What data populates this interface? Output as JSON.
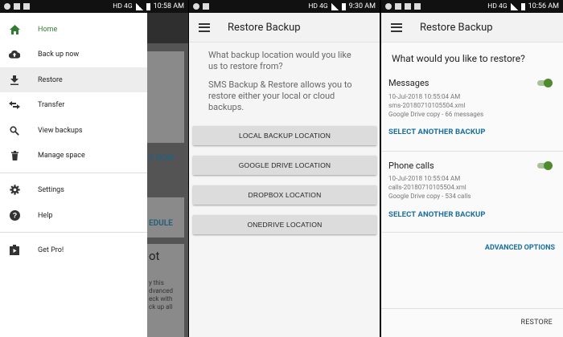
{
  "panel1": {
    "status": {
      "time": "10:58 AM",
      "network": "HD 4G"
    },
    "background": {
      "backup_now_fragment": "P NOW",
      "schedule_fragment": "EDULE",
      "got_fragment": "ot",
      "desc_fragment": [
        "y this",
        "dvanced",
        "eck with",
        "ck up all"
      ]
    },
    "drawer_items": [
      {
        "label": "Home",
        "icon": "home-icon"
      },
      {
        "label": "Back up now",
        "icon": "cloud-upload-icon"
      },
      {
        "label": "Restore",
        "icon": "download-icon"
      },
      {
        "label": "Transfer",
        "icon": "transfer-icon"
      },
      {
        "label": "View backups",
        "icon": "search-icon"
      },
      {
        "label": "Manage space",
        "icon": "trash-icon"
      },
      {
        "label": "Settings",
        "icon": "gear-icon"
      },
      {
        "label": "Help",
        "icon": "help-icon"
      },
      {
        "label": "Get Pro!",
        "icon": "play-store-icon"
      }
    ]
  },
  "panel2": {
    "status": {
      "time": "9:30 AM",
      "network": "HD 4G"
    },
    "title": "Restore Backup",
    "question": "What backup location would you like us to restore from?",
    "description": "SMS Backup & Restore allows you to restore either your local or cloud backups.",
    "buttons": [
      "LOCAL BACKUP LOCATION",
      "GOOGLE DRIVE LOCATION",
      "DROPBOX LOCATION",
      "ONEDRIVE LOCATION"
    ]
  },
  "panel3": {
    "status": {
      "time": "10:56 AM",
      "network": "HD 4G"
    },
    "title": "Restore Backup",
    "question": "What would you like to restore?",
    "messages": {
      "title": "Messages",
      "date": "10-Jul-2018 10:55:04 AM",
      "file": "sms-20180710105504.xml",
      "source": "Google Drive copy - 66 messages",
      "link": "SELECT ANOTHER BACKUP",
      "enabled": true
    },
    "calls": {
      "title": "Phone calls",
      "date": "10-Jul-2018 10:55:04 AM",
      "file": "calls-20180710105504.xml",
      "source": "Google Drive copy - 534 calls",
      "link": "SELECT ANOTHER BACKUP",
      "enabled": true
    },
    "advanced": "ADVANCED OPTIONS",
    "restore": "RESTORE"
  },
  "colors": {
    "accent_green": "#2e7d32",
    "link_blue": "#1a6fa0",
    "toggle_green": "#4f8a2e"
  }
}
